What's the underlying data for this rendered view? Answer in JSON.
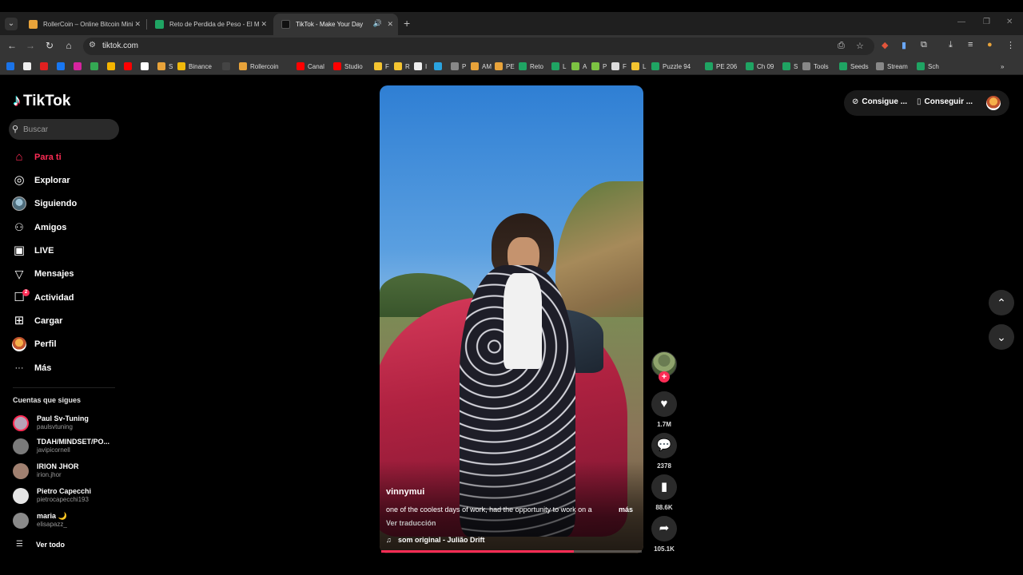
{
  "browser": {
    "tabs": [
      {
        "title": "RollerCoin – Online Bitcoin Mining Simulator",
        "favicon_color": "#e8a33a",
        "active": false
      },
      {
        "title": "Reto de Perdida de Peso - El Mejor",
        "favicon_color": "#1fa463",
        "active": false
      },
      {
        "title": "TikTok - Make Your Day",
        "favicon_color": "#111111",
        "active": true
      }
    ],
    "url": "tiktok.com",
    "bookmarks": [
      {
        "label": "",
        "color": "#1a73e8"
      },
      {
        "label": "",
        "color": "#eeeeee"
      },
      {
        "label": "",
        "color": "#e02020"
      },
      {
        "label": "",
        "color": "#1877f2"
      },
      {
        "label": "",
        "color": "#d6249f"
      },
      {
        "label": "",
        "color": "#34a853"
      },
      {
        "label": "",
        "color": "#f4b400"
      },
      {
        "label": "",
        "color": "#ff0000"
      },
      {
        "label": "",
        "color": "#ffffff"
      },
      {
        "label": "S",
        "color": "#e8a33a"
      },
      {
        "label": "Binance",
        "color": "#f0b90b"
      },
      {
        "label": "",
        "color": "#444444"
      },
      {
        "label": "Rollercoin",
        "color": "#e8a33a"
      },
      {
        "label": "Canal",
        "color": "#ff0000"
      },
      {
        "label": "Studio",
        "color": "#ff0000"
      },
      {
        "label": "F",
        "color": "#f4c430"
      },
      {
        "label": "R",
        "color": "#f4c430"
      },
      {
        "label": "I",
        "color": "#eeeeee"
      },
      {
        "label": "",
        "color": "#2aa3e0"
      },
      {
        "label": "P",
        "color": "#888888"
      },
      {
        "label": "AM",
        "color": "#e8a33a"
      },
      {
        "label": "PE",
        "color": "#e8a33a"
      },
      {
        "label": "Reto",
        "color": "#1fa463"
      },
      {
        "label": "L",
        "color": "#1fa463"
      },
      {
        "label": "A",
        "color": "#7cc242"
      },
      {
        "label": "P",
        "color": "#7cc242"
      },
      {
        "label": "F",
        "color": "#dddddd"
      },
      {
        "label": "L",
        "color": "#f4c430"
      },
      {
        "label": "Puzzle 94",
        "color": "#1fa463"
      },
      {
        "label": "PE 206",
        "color": "#1fa463"
      },
      {
        "label": "Ch 09",
        "color": "#1fa463"
      },
      {
        "label": "S",
        "color": "#1fa463"
      },
      {
        "label": "Tools",
        "color": "#888888"
      },
      {
        "label": "Seeds",
        "color": "#1fa463"
      },
      {
        "label": "Stream",
        "color": "#888888"
      },
      {
        "label": "Sch",
        "color": "#1fa463"
      }
    ],
    "bookmarks_overflow": "»"
  },
  "tiktok": {
    "logo_note": "♪",
    "logo_text": "TikTok",
    "search_placeholder": "Buscar",
    "nav": [
      {
        "label": "Para ti",
        "icon": "home-icon",
        "glyph": "⌂"
      },
      {
        "label": "Explorar",
        "icon": "compass-icon",
        "glyph": "◎"
      },
      {
        "label": "Siguiendo",
        "icon": "following-avatar-icon",
        "glyph": ""
      },
      {
        "label": "Amigos",
        "icon": "friends-icon",
        "glyph": "👥"
      },
      {
        "label": "LIVE",
        "icon": "live-icon",
        "glyph": "▣"
      },
      {
        "label": "Mensajes",
        "icon": "messages-icon",
        "glyph": "➢"
      },
      {
        "label": "Actividad",
        "icon": "activity-icon",
        "glyph": "☐"
      },
      {
        "label": "Cargar",
        "icon": "upload-icon",
        "glyph": "⊞"
      },
      {
        "label": "Perfil",
        "icon": "profile-avatar-icon",
        "glyph": ""
      },
      {
        "label": "Más",
        "icon": "more-icon",
        "glyph": "···"
      }
    ],
    "activity_badge": "2",
    "following_title": "Cuentas que sigues",
    "following": [
      {
        "name": "Paul Sv-Tuning",
        "user": "paulsvtuning",
        "color": "#b7a3b8"
      },
      {
        "name": "TDAH/MINDSET/PO...",
        "user": "javipicornell",
        "color": "#7a7a7a"
      },
      {
        "name": "IRION JHOR",
        "user": "irion.jhor",
        "color": "#a08070"
      },
      {
        "name": "Pietro Capecchi",
        "user": "pietrocapecchi193",
        "color": "#e5e5e5"
      },
      {
        "name": "maria 🌙",
        "user": "elisapazz_",
        "color": "#8a8a8a"
      }
    ],
    "see_all": "Ver todo",
    "top_right": {
      "coins_label": "Consigue ...",
      "app_label": "Conseguir ..."
    },
    "video": {
      "username": "vinnymui",
      "caption": "one of the coolest days of work, had the opportunity to work on a",
      "more": "más",
      "translate": "Ver traducción",
      "sound": "som original - Julião Drift",
      "progress": 0.74
    },
    "actions": {
      "likes": "1.7M",
      "comments": "2378",
      "saves": "88.6K",
      "shares": "105.1K"
    }
  }
}
